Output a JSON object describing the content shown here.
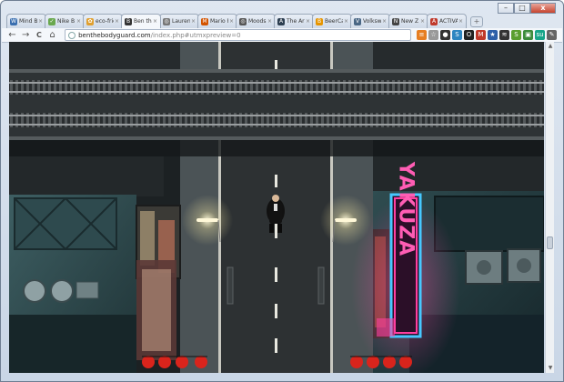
{
  "browser": {
    "tabs": [
      {
        "label": "Mind B",
        "fav_color": "#3a6fb0",
        "fav_glyph": "W"
      },
      {
        "label": "Nike B",
        "fav_color": "#6aa84f",
        "fav_glyph": "✓"
      },
      {
        "label": "eco-frie",
        "fav_color": "#e0a030",
        "fav_glyph": "✿"
      },
      {
        "label": "Ben the",
        "fav_color": "#333333",
        "fav_glyph": "B"
      },
      {
        "label": "Lauren",
        "fav_color": "#777777",
        "fav_glyph": "◎"
      },
      {
        "label": "Mario R",
        "fav_color": "#d35400",
        "fav_glyph": "M"
      },
      {
        "label": "Moods",
        "fav_color": "#555555",
        "fav_glyph": "◎"
      },
      {
        "label": "The Ar",
        "fav_color": "#2c3e50",
        "fav_glyph": "A"
      },
      {
        "label": "BeerCa",
        "fav_color": "#e69500",
        "fav_glyph": "B"
      },
      {
        "label": "Volkswa",
        "fav_color": "#4a6785",
        "fav_glyph": "V"
      },
      {
        "label": "New Z",
        "fav_color": "#444444",
        "fav_glyph": "N"
      },
      {
        "label": "ACTIVA",
        "fav_color": "#c0392b",
        "fav_glyph": "A"
      }
    ],
    "active_tab": 3,
    "url_host": "benthebodyguard.com",
    "url_path": "/index.php#utmxpreview=0",
    "nav": {
      "back": "←",
      "forward": "→",
      "reload": "C",
      "home": "⌂"
    },
    "new_tab": "+",
    "window_controls": {
      "minimize": "–",
      "maximize": "□",
      "close": "x"
    },
    "extensions": [
      {
        "icon": "rss-icon",
        "color": "#e67e22",
        "glyph": "≡"
      },
      {
        "icon": "star-icon",
        "color": "#999999",
        "glyph": "☆"
      },
      {
        "icon": "ext-dark-icon",
        "color": "#333333",
        "glyph": "●"
      },
      {
        "icon": "ext-blue-icon",
        "color": "#2e86c1",
        "glyph": "S"
      },
      {
        "icon": "ext-circle-icon",
        "color": "#222222",
        "glyph": "O"
      },
      {
        "icon": "gmail-icon",
        "color": "#c0392b",
        "glyph": "M"
      },
      {
        "icon": "bookmark-star-icon",
        "color": "#2e5fa8",
        "glyph": "★"
      },
      {
        "icon": "layers-icon",
        "color": "#333333",
        "glyph": "≋"
      },
      {
        "icon": "ext-green-icon",
        "color": "#5a9e2f",
        "glyph": "S"
      },
      {
        "icon": "ext-img-icon",
        "color": "#3c8c3c",
        "glyph": "▣"
      },
      {
        "icon": "ext-su-icon",
        "color": "#17a589",
        "glyph": "su"
      },
      {
        "icon": "wrench-icon",
        "color": "#666666",
        "glyph": "✎"
      }
    ]
  },
  "game": {
    "sign_text": "YAKUZA",
    "colors": {
      "road": "#2b2f31",
      "sidewalk": "#4a5255",
      "bridge": "#2f3436",
      "neon_pink": "#ff3fa0",
      "neon_blue": "#46c8ff",
      "lantern": "#d9241c",
      "lamp_glow": "#fff6c8"
    }
  }
}
